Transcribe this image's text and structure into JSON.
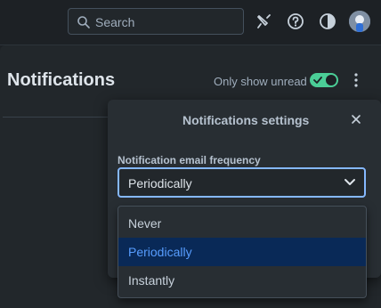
{
  "search": {
    "placeholder": "Search"
  },
  "header": {
    "icons": [
      "notification-bell-icon",
      "help-icon",
      "theme-toggle-icon",
      "avatar"
    ]
  },
  "notifications": {
    "title": "Notifications",
    "only_unread_label": "Only show unread",
    "only_unread_enabled": true
  },
  "settings": {
    "title": "Notifications settings",
    "email_frequency_label": "Notification email frequency",
    "email_frequency_value": "Periodically",
    "options": [
      {
        "label": "Never",
        "selected": false
      },
      {
        "label": "Periodically",
        "selected": true
      },
      {
        "label": "Instantly",
        "selected": false
      }
    ]
  },
  "colors": {
    "accent": "#85b8ff",
    "toggle_on": "#4bce97",
    "selected_bg": "#092957"
  }
}
